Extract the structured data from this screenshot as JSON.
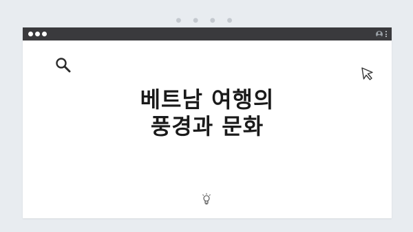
{
  "window": {
    "title_lines": [
      "베트남 여행의",
      "풍경과 문화"
    ]
  },
  "icons": {
    "search": "search-icon",
    "cursor": "cursor-icon",
    "bulb": "bulb-icon",
    "user": "user-icon",
    "menu": "kebab-menu-icon"
  },
  "colors": {
    "background": "#e8ecf0",
    "titlebar": "#3a3a3d",
    "window": "#ffffff",
    "text": "#1a1a1a"
  }
}
